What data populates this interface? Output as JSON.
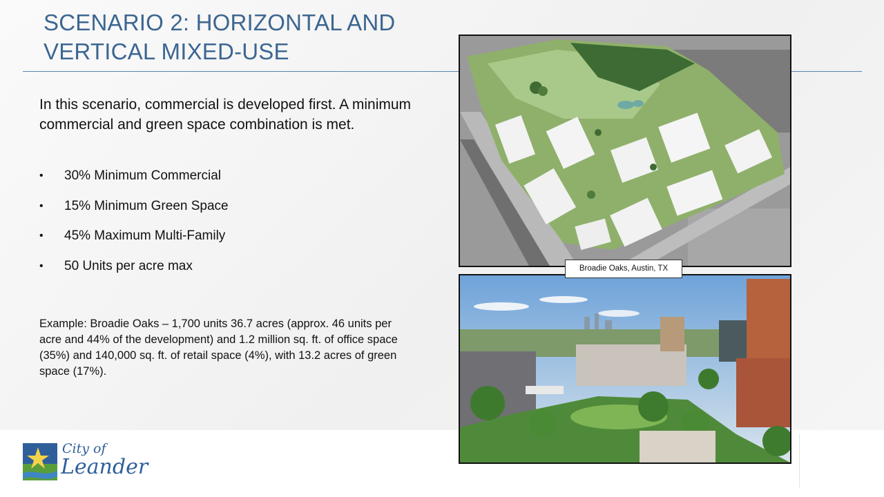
{
  "slide": {
    "title_line1": "SCENARIO 2: HORIZONTAL AND",
    "title_line2": "VERTICAL MIXED-USE",
    "intro": "In this scenario, commercial is developed first. A minimum commercial and green space combination is met.",
    "bullets": [
      "30% Minimum Commercial",
      "15% Minimum Green Space",
      "45% Maximum Multi-Family",
      "50 Units per acre max"
    ],
    "bullet_glyph": "•",
    "example": "Example: Broadie Oaks – 1,700 units 36.7 acres (approx. 46 units per acre and 44% of the development) and 1.2 million sq. ft. of office space (35%) and 140,000 sq. ft. of retail space (4%), with 13.2 acres of green space (17%).",
    "image_caption": "Broadie Oaks, Austin, TX"
  },
  "logo": {
    "line1": "City of",
    "line2": "Leander",
    "icon": "star-landscape-icon"
  },
  "colors": {
    "title": "#3c6691",
    "rule": "#5b84b1",
    "logo": "#2f5f9a"
  }
}
